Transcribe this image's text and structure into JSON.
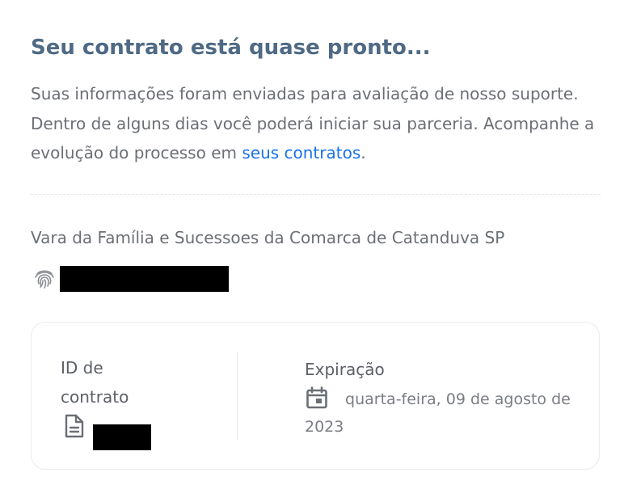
{
  "header": {
    "title": "Seu contrato está quase pronto..."
  },
  "description": {
    "text_before_link": "Suas informações foram enviadas para avaliação de nosso suporte. Dentro de alguns dias você poderá iniciar sua parceria. Acompanhe a evolução do processo em ",
    "link_text": "seus contratos",
    "text_after_link": "."
  },
  "party": {
    "court_name": "Vara da Família e Sucessoes da Comarca de Catanduva SP",
    "document_icon": "fingerprint-icon"
  },
  "contract_card": {
    "id_label": "ID de contrato",
    "id_icon": "document-icon",
    "expiration_label": "Expiração",
    "expiration_icon": "calendar-icon",
    "expiration_date": "quarta-feira, 09 de agosto de 2023"
  },
  "colors": {
    "title": "#4e6a85",
    "link": "#1a73e8",
    "body_text": "#6b6f75"
  }
}
